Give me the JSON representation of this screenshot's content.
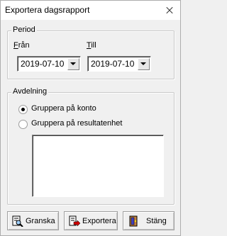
{
  "window": {
    "title": "Exportera dagsrapport"
  },
  "period": {
    "group_label": "Period",
    "from_label": "Från",
    "to_label": "Till",
    "from_value": "2019-07-10",
    "to_value": "2019-07-10"
  },
  "avdelning": {
    "group_label": "Avdelning",
    "options": [
      {
        "label": "Gruppera på konto",
        "checked": true
      },
      {
        "label": "Gruppera på resultatenhet",
        "checked": false
      }
    ]
  },
  "buttons": {
    "preview": "Granska",
    "export": "Exportera",
    "close": "Stäng"
  }
}
